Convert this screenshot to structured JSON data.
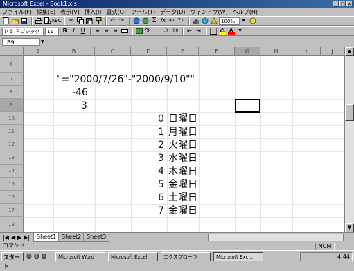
{
  "window": {
    "title": "Microsoft Excel - Book1.xls",
    "controls": [
      "_",
      "□",
      "×"
    ]
  },
  "menubar": {
    "items": [
      "ファイル(F)",
      "編集(E)",
      "表示(V)",
      "挿入(I)",
      "書式(O)",
      "ツール(T)",
      "データ(D)",
      "ウィンドウ(W)",
      "ヘルプ(H)"
    ]
  },
  "toolbar": {
    "zoom": "100%",
    "font_name": "ＭＳ Ｐゴシック",
    "font_size": "11"
  },
  "formula_bar": {
    "name_box": "B9"
  },
  "grid": {
    "columns": [
      "A",
      "B",
      "C",
      "D",
      "E",
      "F",
      "G",
      "H",
      "I",
      "J"
    ],
    "rows": [
      "6",
      "7",
      "8",
      "9",
      "10",
      "11",
      "12",
      "13",
      "14",
      "15",
      "16",
      "17",
      "18"
    ],
    "formula_text": "\"=\"2000/7/26\"-\"2000/9/10\"\"",
    "diff_value": "-46",
    "weekday_value": "3",
    "weekday_table": [
      {
        "num": "0",
        "day": "日曜日"
      },
      {
        "num": "1",
        "day": "月曜日"
      },
      {
        "num": "2",
        "day": "火曜日"
      },
      {
        "num": "3",
        "day": "水曜日"
      },
      {
        "num": "4",
        "day": "木曜日"
      },
      {
        "num": "5",
        "day": "金曜日"
      },
      {
        "num": "6",
        "day": "土曜日"
      },
      {
        "num": "7",
        "day": "金曜日"
      }
    ]
  },
  "sheet_tabs": [
    "Sheet1",
    "Sheet2",
    "Sheet3"
  ],
  "statusbar": {
    "text": "コマンド",
    "mode": "NUM"
  },
  "taskbar": {
    "start": "スタート",
    "tasks": [
      "Microsoft Word",
      "Microsoft Excel",
      "エクスプローラ",
      "Microsoft Exc..."
    ],
    "clock": "4:44"
  }
}
